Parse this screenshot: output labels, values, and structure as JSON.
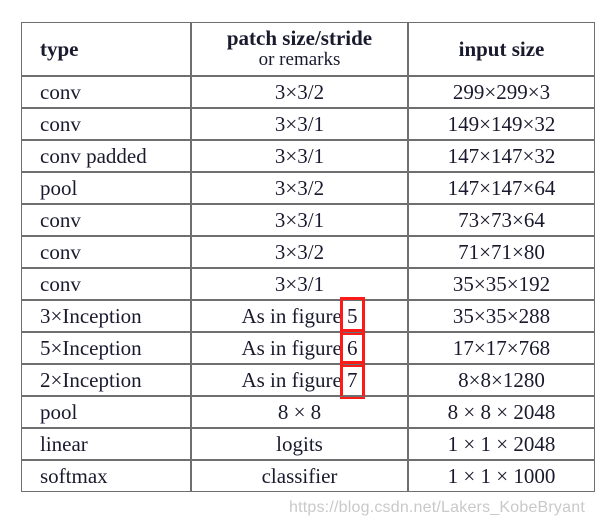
{
  "table": {
    "headers": {
      "type": "type",
      "patch_line1": "patch size/stride",
      "patch_line2": "or remarks",
      "input": "input size"
    },
    "rows": [
      {
        "type": "conv",
        "patch": "3×3/2",
        "input": "299×299×3"
      },
      {
        "type": "conv",
        "patch": "3×3/1",
        "input": "149×149×32"
      },
      {
        "type": "conv padded",
        "patch": "3×3/1",
        "input": "147×147×32"
      },
      {
        "type": "pool",
        "patch": "3×3/2",
        "input": "147×147×64"
      },
      {
        "type": "conv",
        "patch": "3×3/1",
        "input": "73×73×64"
      },
      {
        "type": "conv",
        "patch": "3×3/2",
        "input": "71×71×80"
      },
      {
        "type": "conv",
        "patch": "3×3/1",
        "input": "35×35×192"
      },
      {
        "type": "3×Inception",
        "patch_prefix": "As in figure ",
        "patch_ref": "5",
        "highlighted": true,
        "input": "35×35×288"
      },
      {
        "type": "5×Inception",
        "patch_prefix": "As in figure ",
        "patch_ref": "6",
        "highlighted": true,
        "input": "17×17×768"
      },
      {
        "type": "2×Inception",
        "patch_prefix": "As in figure ",
        "patch_ref": "7",
        "highlighted": true,
        "input": "8×8×1280"
      },
      {
        "type": "pool",
        "patch": "8 × 8",
        "input": "8 × 8 × 2048"
      },
      {
        "type": "linear",
        "patch": "logits",
        "input": "1 × 1 × 2048"
      },
      {
        "type": "softmax",
        "patch": "classifier",
        "input": "1 × 1 × 1000"
      }
    ]
  },
  "annotation": {
    "box_color": "#fb1b18",
    "boxed_values": [
      "5",
      "6",
      "7"
    ]
  },
  "watermark": {
    "text": "https://blog.csdn.net/Lakers_KobeBryant"
  }
}
